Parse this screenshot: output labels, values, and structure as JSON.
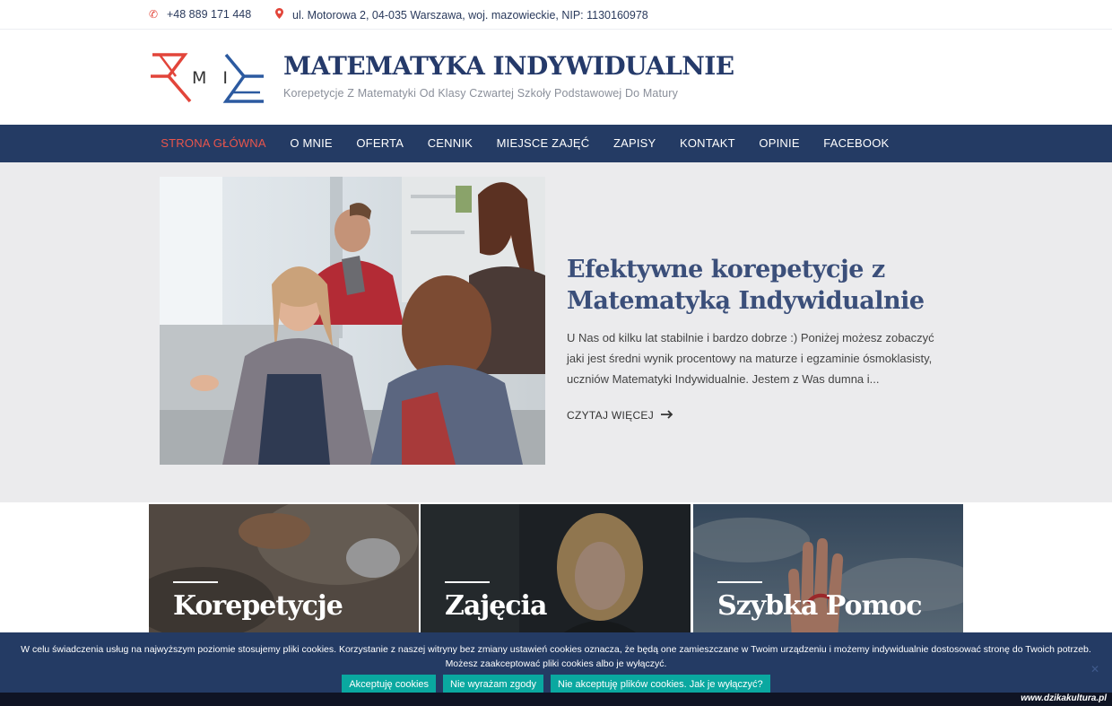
{
  "topbar": {
    "phone": "+48 889 171 448",
    "address": "ul. Motorowa 2, 04-035 Warszawa, woj. mazowieckie, NIP: 1130160978",
    "phone_icon": "phone-icon",
    "address_icon": "map-marker-icon"
  },
  "header": {
    "logo_text": "M I",
    "title": "MATEMATYKA INDYWIDUALNIE",
    "tagline": "Korepetycje Z Matematyki Od Klasy Czwartej Szkoły Podstawowej Do Matury"
  },
  "nav": {
    "items": [
      {
        "label": "STRONA GŁÓWNA",
        "active": true
      },
      {
        "label": "O MNIE"
      },
      {
        "label": "OFERTA"
      },
      {
        "label": "CENNIK"
      },
      {
        "label": "MIEJSCE ZAJĘĆ"
      },
      {
        "label": "ZAPISY"
      },
      {
        "label": "KONTAKT"
      },
      {
        "label": "OPINIE"
      },
      {
        "label": "FACEBOOK"
      }
    ]
  },
  "hero": {
    "title": "Efektywne korepetycje z Matematyką Indywidualnie",
    "text": "U Nas od kilku lat stabilnie i bardzo dobrze :) Poniżej możesz zobaczyć jaki jest średni wynik procentowy na maturze i egzaminie ósmoklasisty, uczniów Matematyki Indywidualnie. Jestem z Was dumna i...",
    "read_more": "CZYTAJ WIĘCEJ"
  },
  "cards": [
    {
      "title": "Korepetycje"
    },
    {
      "title": "Zajęcia"
    },
    {
      "title": "Szybka Pomoc"
    }
  ],
  "cookie": {
    "line1": "W celu świadczenia usług na najwyższym poziomie stosujemy pliki cookies. Korzystanie z naszej witryny bez zmiany ustawień cookies oznacza, że będą one zamieszczane w Twoim urządzeniu i możemy indywidualnie dostosować stronę do Twoich potrzeb.",
    "line2": "Możesz zaakceptować pliki cookies albo je wyłączyć.",
    "accept": "Akceptuję cookies",
    "reject": "Nie wyrażam zgody",
    "howto": "Nie akceptuję plików cookies. Jak je wyłączyć?",
    "close": "✕"
  },
  "watermark": "www.dzikakultura.pl",
  "colors": {
    "brand_navy": "#243b64",
    "accent_red": "#e9554c",
    "button_teal": "#0aa8a0"
  }
}
